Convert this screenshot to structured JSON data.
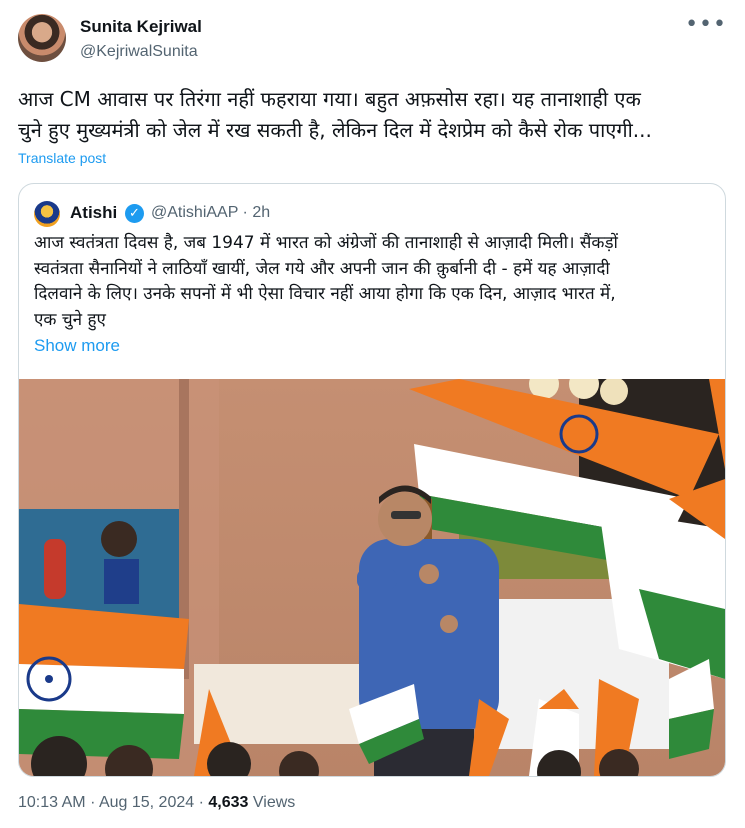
{
  "author": {
    "name": "Sunita Kejriwal",
    "handle": "@KejriwalSunita"
  },
  "menu_icon": "more-horizontal-icon",
  "post": {
    "text_line1": "आज CM आवास पर तिरंगा नहीं फहराया गया। बहुत अफ़सोस रहा। यह तानाशाही एक",
    "text_line2": "चुने हुए मुख्यमंत्री को जेल में रख सकती है, लेकिन दिल में देशप्रेम को कैसे रोक पाएगी...",
    "translate_label": "Translate post"
  },
  "quoted": {
    "name": "Atishi",
    "verified_icon": "verified-badge-icon",
    "handle_time": "@AtishiAAP · 2h",
    "text_line1": "आज स्वतंत्रता दिवस है, जब 1947 में भारत को अंग्रेजों की तानाशाही से आज़ादी मिली। सैंकड़ों",
    "text_line2": "स्वतंत्रता सैनानियों ने लाठियाँ खायीं, जेल गये और अपनी जान की क़ुर्बानी दी - हमें यह आज़ादी",
    "text_line3": "दिलवाने के लिए। उनके सपनों में भी ऐसा विचार नहीं आया होगा कि एक दिन, आज़ाद भारत में,",
    "text_line4": "एक चुने हुए",
    "show_more_label": "Show more"
  },
  "meta": {
    "time": "10:13 AM",
    "separator": "·",
    "date": "Aug 15, 2024",
    "views_count": "4,633",
    "views_label": "Views"
  },
  "colors": {
    "link": "#1d9bf0",
    "secondary_text": "#536471",
    "saffron": "#f07a22",
    "green": "#2f8a3a"
  }
}
